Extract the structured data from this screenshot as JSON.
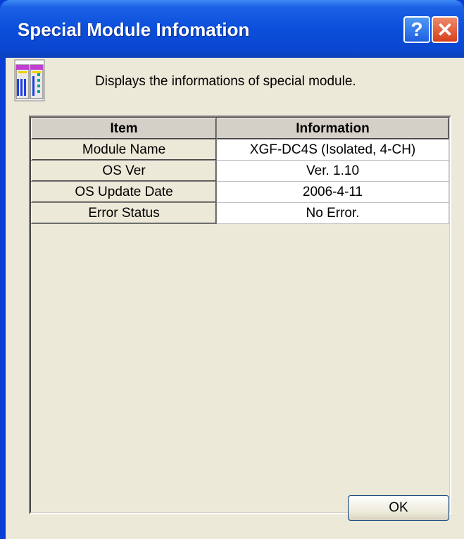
{
  "window": {
    "title": "Special Module Infomation",
    "help_glyph": "?",
    "close_glyph": "✕"
  },
  "header": {
    "icon": "module-rack-icon",
    "description": "Displays the informations of special module."
  },
  "grid": {
    "columns": [
      "Item",
      "Information"
    ],
    "rows": [
      {
        "item": "Module Name",
        "info": "XGF-DC4S (Isolated, 4-CH)"
      },
      {
        "item": "OS Ver",
        "info": "Ver.  1.10"
      },
      {
        "item": "OS Update Date",
        "info": "2006-4-11"
      },
      {
        "item": "Error Status",
        "info": "No Error."
      }
    ]
  },
  "buttons": {
    "ok_label": "OK"
  },
  "colors": {
    "titlebar": "#0a4edb",
    "dialog_face": "#ece9d8",
    "close_button": "#d6401c"
  }
}
